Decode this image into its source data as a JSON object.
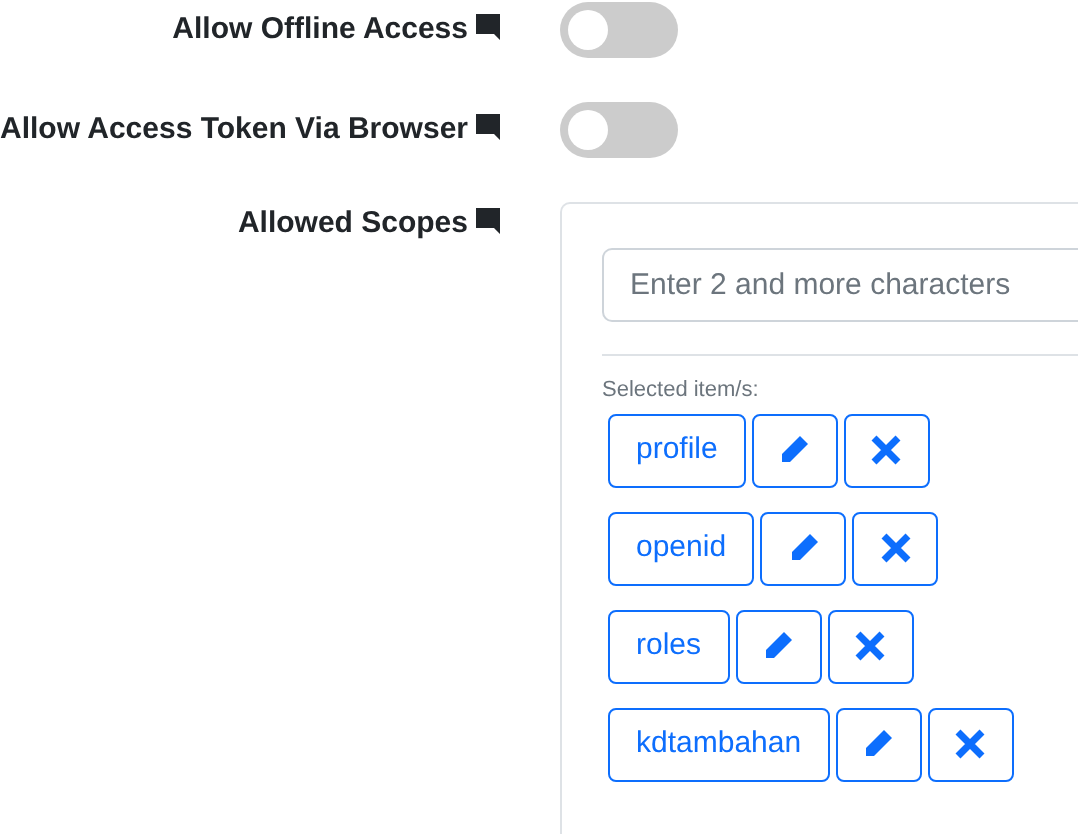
{
  "fields": [
    {
      "kind": "toggle",
      "label": "Allow Offline Access",
      "on": false
    },
    {
      "kind": "toggle",
      "label": "Allow Access Token Via Browser",
      "on": false
    },
    {
      "kind": "scopes",
      "label": "Allowed Scopes",
      "search": {
        "placeholder": "Enter 2 and more characters"
      },
      "selected_label": "Selected item/s:",
      "items": [
        "profile",
        "openid",
        "roles",
        "kdtambahan"
      ]
    }
  ]
}
